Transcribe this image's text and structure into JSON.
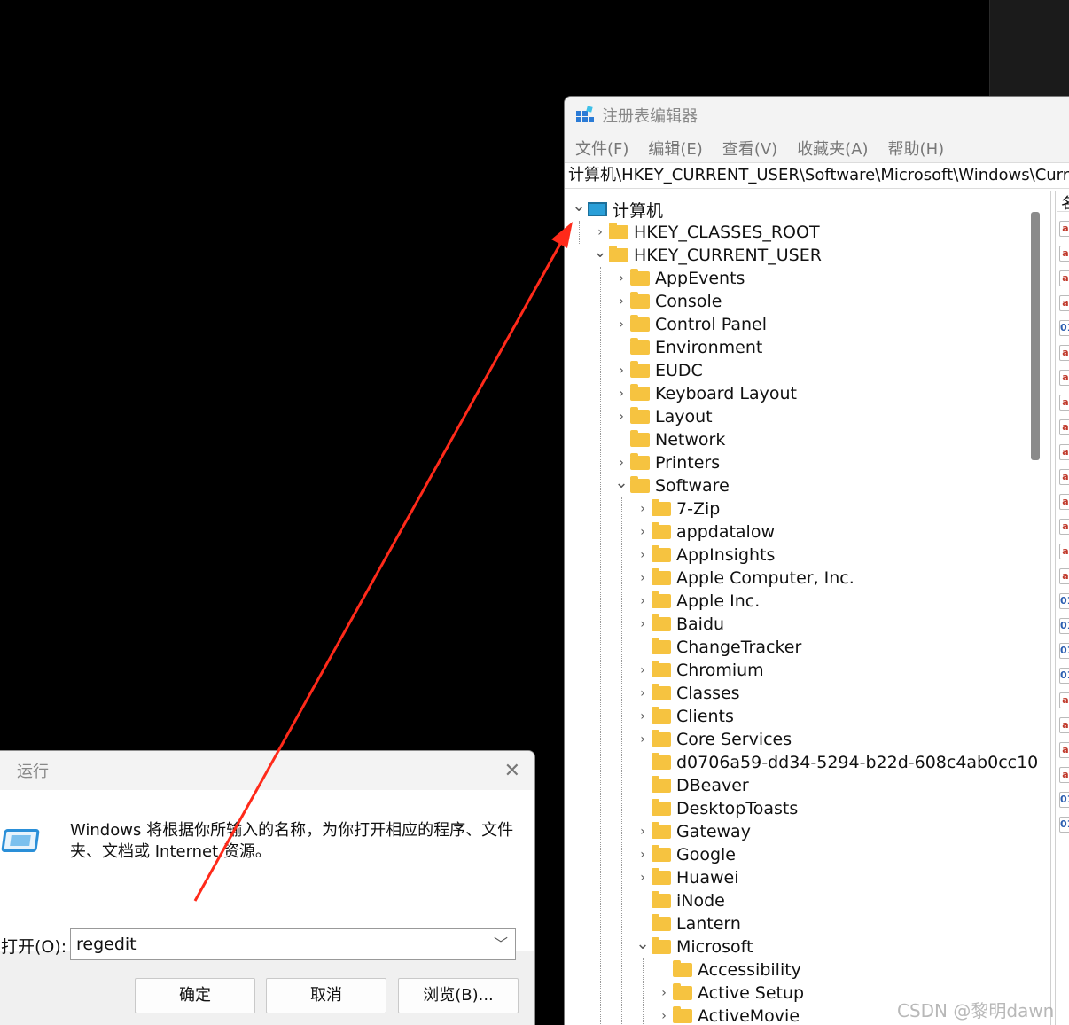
{
  "regedit": {
    "title": "注册表编辑器",
    "menu": [
      "文件(F)",
      "编辑(E)",
      "查看(V)",
      "收藏夹(A)",
      "帮助(H)"
    ],
    "address": "计算机\\HKEY_CURRENT_USER\\Software\\Microsoft\\Windows\\CurrentVersion",
    "right_header": "名",
    "value_icons": [
      "ab",
      "ab",
      "ab",
      "ab",
      "dw",
      "ab",
      "ab",
      "ab",
      "ab",
      "ab",
      "ab",
      "ab",
      "ab",
      "ab",
      "ab",
      "dw",
      "dw",
      "dw",
      "dw",
      "ab",
      "ab",
      "ab",
      "ab",
      "dw",
      "dw"
    ],
    "tree": [
      {
        "label": "计算机",
        "level": 0,
        "expander": "open",
        "icon": "computer"
      },
      {
        "label": "HKEY_CLASSES_ROOT",
        "level": 1,
        "expander": "closed"
      },
      {
        "label": "HKEY_CURRENT_USER",
        "level": 1,
        "expander": "open"
      },
      {
        "label": "AppEvents",
        "level": 2,
        "expander": "closed"
      },
      {
        "label": "Console",
        "level": 2,
        "expander": "closed"
      },
      {
        "label": "Control Panel",
        "level": 2,
        "expander": "closed"
      },
      {
        "label": "Environment",
        "level": 2,
        "expander": "none"
      },
      {
        "label": "EUDC",
        "level": 2,
        "expander": "closed"
      },
      {
        "label": "Keyboard Layout",
        "level": 2,
        "expander": "closed"
      },
      {
        "label": "Layout",
        "level": 2,
        "expander": "closed"
      },
      {
        "label": "Network",
        "level": 2,
        "expander": "none"
      },
      {
        "label": "Printers",
        "level": 2,
        "expander": "closed"
      },
      {
        "label": "Software",
        "level": 2,
        "expander": "open"
      },
      {
        "label": "7-Zip",
        "level": 3,
        "expander": "closed"
      },
      {
        "label": "appdatalow",
        "level": 3,
        "expander": "closed"
      },
      {
        "label": "AppInsights",
        "level": 3,
        "expander": "closed"
      },
      {
        "label": "Apple Computer, Inc.",
        "level": 3,
        "expander": "closed"
      },
      {
        "label": "Apple Inc.",
        "level": 3,
        "expander": "closed"
      },
      {
        "label": "Baidu",
        "level": 3,
        "expander": "closed"
      },
      {
        "label": "ChangeTracker",
        "level": 3,
        "expander": "none"
      },
      {
        "label": "Chromium",
        "level": 3,
        "expander": "closed"
      },
      {
        "label": "Classes",
        "level": 3,
        "expander": "closed"
      },
      {
        "label": "Clients",
        "level": 3,
        "expander": "closed"
      },
      {
        "label": "Core Services",
        "level": 3,
        "expander": "closed"
      },
      {
        "label": "d0706a59-dd34-5294-b22d-608c4ab0cc10",
        "level": 3,
        "expander": "none"
      },
      {
        "label": "DBeaver",
        "level": 3,
        "expander": "none"
      },
      {
        "label": "DesktopToasts",
        "level": 3,
        "expander": "none"
      },
      {
        "label": "Gateway",
        "level": 3,
        "expander": "closed"
      },
      {
        "label": "Google",
        "level": 3,
        "expander": "closed"
      },
      {
        "label": "Huawei",
        "level": 3,
        "expander": "closed"
      },
      {
        "label": "iNode",
        "level": 3,
        "expander": "none"
      },
      {
        "label": "Lantern",
        "level": 3,
        "expander": "none"
      },
      {
        "label": "Microsoft",
        "level": 3,
        "expander": "open"
      },
      {
        "label": "Accessibility",
        "level": 4,
        "expander": "none"
      },
      {
        "label": "Active Setup",
        "level": 4,
        "expander": "closed"
      },
      {
        "label": "ActiveMovie",
        "level": 4,
        "expander": "closed"
      }
    ]
  },
  "run": {
    "title": "运行",
    "description": "Windows 将根据你所输入的名称，为你打开相应的程序、文件夹、文档或 Internet 资源。",
    "open_label": "打开(O):",
    "input_value": "regedit",
    "buttons": {
      "ok": "确定",
      "cancel": "取消",
      "browse": "浏览(B)..."
    }
  },
  "annotation": {
    "arrow_color": "#ff2a1a"
  },
  "watermark": "CSDN @黎明dawn"
}
